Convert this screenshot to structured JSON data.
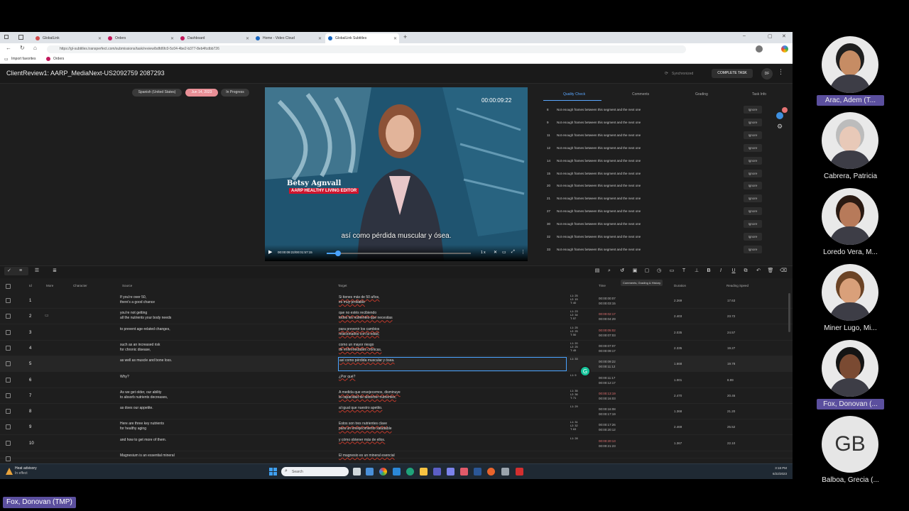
{
  "browser": {
    "tabs": [
      {
        "label": "GlobalLink",
        "color": "#d04a4a"
      },
      {
        "label": "Orders",
        "color": "#c2185b"
      },
      {
        "label": "Dashboard",
        "color": "#c2185b"
      },
      {
        "label": "Home - Video Cloud",
        "color": "#1565c0"
      },
      {
        "label": "GlobalLink Subtitles",
        "color": "#1565c0"
      }
    ],
    "new_tab": "+",
    "url": "https://gl-subtitles.transperfect.com/submissions/task/review/bdfd6fc0-5c04-4be2-b377-8eb4fcdbb726",
    "favorites": [
      "Import favorites",
      "Orders"
    ]
  },
  "app": {
    "title": "ClientReview1: AARP_MediaNext-US2092759 2087293",
    "sync_status": "Synchronized",
    "complete_button": "COMPLETE TASK",
    "user_initials": "DF",
    "pills": {
      "language": "Spanish (United States)",
      "date": "Jun 14, 2023",
      "status": "In Progress"
    }
  },
  "video": {
    "timestamp_overlay": "00:00:09:22",
    "name_title": "Betsy Agnvall",
    "name_subtitle": "AARP HEALTHY LIVING EDITOR",
    "subtitle": "así como pérdida muscular y ósea.",
    "time_readout": "00:00:09:22/00:01:57:15",
    "speed": "1 x",
    "progress": 0.08
  },
  "panel": {
    "tabs": [
      "Quality Check",
      "Comments",
      "Grading",
      "Task Info"
    ],
    "active_tab": 0,
    "issues": [
      {
        "n": "8",
        "text": "Not enough frames between this segment and the next one",
        "action": "Ignore"
      },
      {
        "n": "9",
        "text": "Not enough frames between this segment and the next one",
        "action": "Ignore"
      },
      {
        "n": "11",
        "text": "Not enough frames between this segment and the next one",
        "action": "Ignore"
      },
      {
        "n": "12",
        "text": "Not enough frames between this segment and the next one",
        "action": "Ignore"
      },
      {
        "n": "14",
        "text": "Not enough frames between this segment and the next one",
        "action": "Ignore"
      },
      {
        "n": "15",
        "text": "Not enough frames between this segment and the next one",
        "action": "Ignore"
      },
      {
        "n": "20",
        "text": "Not enough frames between this segment and the next one",
        "action": "Ignore"
      },
      {
        "n": "21",
        "text": "Not enough frames between this segment and the next one",
        "action": "Ignore"
      },
      {
        "n": "27",
        "text": "Not enough frames between this segment and the next one",
        "action": "Ignore"
      },
      {
        "n": "30",
        "text": "Not enough frames between this segment and the next one",
        "action": "Ignore"
      },
      {
        "n": "32",
        "text": "Not enough frames between this segment and the next one",
        "action": "Ignore"
      },
      {
        "n": "33",
        "text": "Not enough frames between this segment and the next one",
        "action": "Ignore"
      }
    ]
  },
  "toolbar": {
    "tooltip": "Comments, Grading & History"
  },
  "grid": {
    "headers": {
      "id": "Id",
      "more": "More",
      "character": "Character",
      "source": "Source",
      "target": "Target",
      "time": "Time",
      "duration": "Duration",
      "reading_speed": "Reading Speed"
    },
    "rows": [
      {
        "id": "1",
        "src": [
          "If you're over 50,",
          "there's a good chance"
        ],
        "tgt": [
          "Si tienes más de 50 años,",
          "es muy probable"
        ],
        "lc": [
          "L1: 25",
          "L2: 15",
          "T: 40"
        ],
        "tm": [
          "00:00:00:07",
          "00:00:03:15"
        ],
        "du": "2.269",
        "rs": "17.63"
      },
      {
        "id": "2",
        "src": [
          "you're not getting",
          "all the nutrients your body needs"
        ],
        "tgt": [
          "que no estés recibiendo",
          "todos los nutrientes que necesitas"
        ],
        "lc": [
          "L1: 23",
          "L2: 34",
          "T: 57"
        ],
        "tm": [
          "00:00:02:17",
          "00:00:04:29"
        ],
        "du": "2.403",
        "rs": "23.72"
      },
      {
        "id": "3",
        "src": [
          "to prevent age-related changes,"
        ],
        "tgt": [
          "para prevenir los cambios",
          "relacionados con la edad,"
        ],
        "lc": [
          "L1: 25",
          "L2: 25",
          "T: 50"
        ],
        "tm": [
          "00:00:05:02",
          "00:00:07:03"
        ],
        "du": "2.035",
        "rs": "24.57"
      },
      {
        "id": "4",
        "src": [
          "such as an increased risk",
          "for chronic disease,"
        ],
        "tgt": [
          "como un mayor riesgo",
          "de enfermedades crónicas,"
        ],
        "lc": [
          "L1: 20",
          "L2: 25",
          "T: 45"
        ],
        "tm": [
          "00:00:07:07",
          "00:00:09:17"
        ],
        "du": "2.335",
        "rs": "19.27"
      },
      {
        "id": "5",
        "src": [
          "as well as muscle and bone loss."
        ],
        "tgt": [
          "así como pérdida muscular y ósea."
        ],
        "lc": [
          "L1: 33"
        ],
        "tm": [
          "00:00:09:22",
          "00:00:11:12"
        ],
        "du": "1.668",
        "rs": "19.78"
      },
      {
        "id": "6",
        "src": [
          "Why?"
        ],
        "tgt": [
          "¿Por qué?"
        ],
        "lc": [
          "L1: 9"
        ],
        "tm": [
          "00:00:11:17",
          "00:00:12:17"
        ],
        "du": "1.001",
        "rs": "8.99"
      },
      {
        "id": "7",
        "src": [
          "As we get older, our ability",
          "to absorb nutrients decreases,"
        ],
        "tgt": [
          "A medida que envejecemos, disminuye",
          "la capacidad de absorber nutrientes,"
        ],
        "lc": [
          "L1: 35",
          "L2: 36",
          "T: 71"
        ],
        "tm": [
          "00:00:13:19",
          "00:00:16:03"
        ],
        "du": "2.470",
        "rs": "20.46"
      },
      {
        "id": "8",
        "src": [
          "as does our appetite."
        ],
        "tgt": [
          "al igual que nuestro apetito."
        ],
        "lc": [
          "L1: 29"
        ],
        "tm": [
          "00:00:16:08",
          "00:00:17:19"
        ],
        "du": "1.368",
        "rs": "21.20"
      },
      {
        "id": "9",
        "src": [
          "Here are three key nutrients",
          "for healthy aging"
        ],
        "tgt": [
          "Estos son tres nutrientes clave",
          "para un envejecimiento saludable"
        ],
        "lc": [
          "L1: 31",
          "L2: 32",
          "T: 63"
        ],
        "tm": [
          "00:00:17:26",
          "00:00:20:12"
        ],
        "du": "2.469",
        "rs": "25.52"
      },
      {
        "id": "10",
        "src": [
          "and how to get more of them."
        ],
        "tgt": [
          "y cómo obtener más de ellos."
        ],
        "lc": [
          "L1: 28"
        ],
        "tm": [
          "00:00:20:13",
          "00:00:21:23"
        ],
        "du": "1.367",
        "rs": "22.10"
      },
      {
        "id": "",
        "src": [
          "Magnesium is an essential mineral"
        ],
        "tgt": [
          "El magnesio es un mineral esencial"
        ],
        "lc": [],
        "tm": [],
        "du": "",
        "rs": ""
      }
    ]
  },
  "taskbar": {
    "weather_title": "Heat advisory",
    "weather_sub": "In effect",
    "search": "Search",
    "time": "3:18 PM",
    "date": "6/22/2023"
  },
  "participants": [
    {
      "name": "Arac, Adem (T...",
      "initials": "",
      "highlight": true
    },
    {
      "name": "Cabrera, Patricia",
      "initials": "",
      "highlight": false
    },
    {
      "name": "Loredo Vera, M...",
      "initials": "",
      "highlight": false
    },
    {
      "name": "Miner Lugo, Mi...",
      "initials": "",
      "highlight": false
    },
    {
      "name": "Fox, Donovan (...",
      "initials": "",
      "highlight": true
    },
    {
      "name": "Balboa, Grecia (...",
      "initials": "GB",
      "highlight": false
    }
  ],
  "presenter": "Fox, Donovan (TMP)"
}
